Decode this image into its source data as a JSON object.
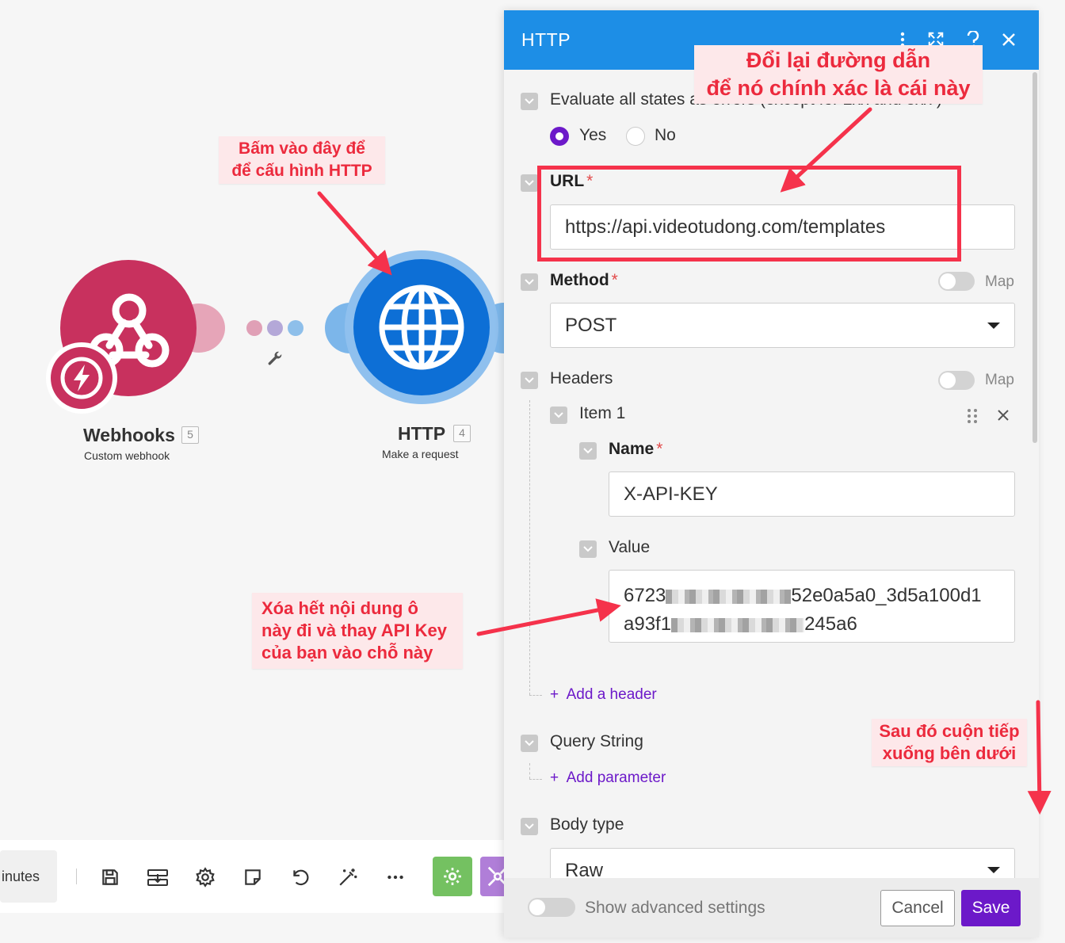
{
  "canvas": {
    "webhook_node": {
      "title": "Webhooks",
      "count": "5",
      "subtitle": "Custom webhook",
      "color": "#c8315e"
    },
    "http_node": {
      "title": "HTTP",
      "count": "4",
      "subtitle": "Make a request",
      "color": "#0d6fd6"
    },
    "link_dots": [
      "#e0a0b6",
      "#b4a8d8",
      "#8ebfea"
    ],
    "toolbar": {
      "minutes_label": "inutes",
      "buttons": [
        "save-icon",
        "auto-align-icon",
        "settings-icon",
        "notes-icon",
        "undo-icon",
        "magic-wand-icon",
        "more-icon"
      ],
      "green_button_color": "#74c161",
      "purple_button_color": "#b07ed8"
    }
  },
  "annotations": {
    "click_http": "Bấm vào đây để\nđể cấu hình HTTP",
    "change_url": "Đổi lại đường dẫn\nđể nó chính xác là cái này",
    "replace_key": "Xóa hết nội dung ô\nnày đi và thay API Key\ncủa bạn vào chỗ này",
    "scroll_down": "Sau đó cuộn tiếp\nxuống bên dưới",
    "accent_color": "#f5324b"
  },
  "panel": {
    "title": "HTTP",
    "header_color": "#1d8ee6",
    "evaluate": {
      "label": "Evaluate all states as errors (except for 2xx and 3xx )",
      "yes": "Yes",
      "no": "No",
      "selected": "Yes"
    },
    "url": {
      "label": "URL",
      "required": "*",
      "value": "https://api.videotudong.com/templates"
    },
    "method": {
      "label": "Method",
      "required": "*",
      "map": "Map",
      "value": "POST"
    },
    "headers": {
      "label": "Headers",
      "map": "Map",
      "item_label": "Item 1",
      "name_label": "Name",
      "name_required": "*",
      "name_value": "X-API-KEY",
      "value_label": "Value",
      "value_line1_start": "6723",
      "value_line1_end": "52e0a5a0_3d5a100d1",
      "value_line2_start": "a93f1",
      "value_line2_end": "245a6",
      "add_header": "Add a header"
    },
    "query_string": {
      "label": "Query String",
      "add_parameter": "Add parameter"
    },
    "body_type": {
      "label": "Body type",
      "value": "Raw"
    },
    "footer": {
      "advanced": "Show advanced settings",
      "cancel": "Cancel",
      "save": "Save",
      "save_color": "#6c19c9"
    }
  }
}
